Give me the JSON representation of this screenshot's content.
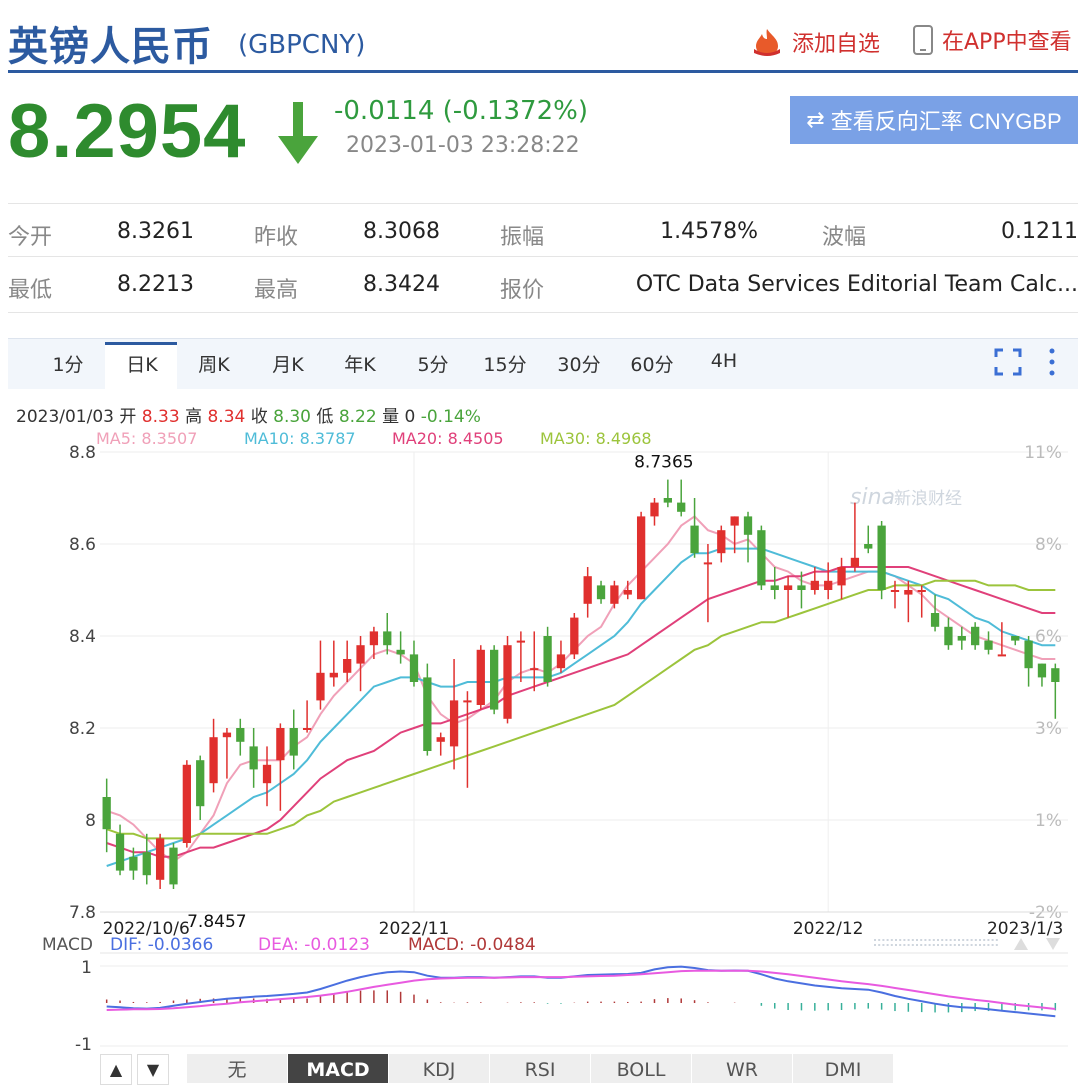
{
  "header": {
    "title": "英镑人民币",
    "code": "(GBPCNY)",
    "fav_label": "添加自选",
    "app_label": "在APP中查看"
  },
  "quote": {
    "price": "8.2954",
    "change": "-0.0114 (-0.1372%)",
    "timestamp": "2023-01-03 23:28:22",
    "reverse_label": "查看反向汇率 CNYGBP"
  },
  "stats": [
    [
      {
        "label": "今开",
        "value": "8.3261"
      },
      {
        "label": "昨收",
        "value": "8.3068"
      },
      {
        "label": "振幅",
        "value": "1.4578%"
      },
      {
        "label": "波幅",
        "value": "0.1211"
      }
    ],
    [
      {
        "label": "最低",
        "value": "8.2213"
      },
      {
        "label": "最高",
        "value": "8.3424"
      },
      {
        "label": "报价",
        "value": "OTC Data Services Editorial Team Calc..."
      }
    ]
  ],
  "tabs": [
    "1分",
    "日K",
    "周K",
    "月K",
    "年K",
    "5分",
    "15分",
    "30分",
    "60分",
    "4H"
  ],
  "active_tab": "日K",
  "info_line": {
    "date": "2023/01/03",
    "open_l": "开",
    "open": "8.33",
    "high_l": "高",
    "high": "8.34",
    "close_l": "收",
    "close": "8.30",
    "low_l": "低",
    "low": "8.22",
    "vol_l": "量",
    "vol": "0",
    "pct": "-0.14%"
  },
  "ma": [
    {
      "label": "MA5: 8.3507",
      "color": "#f0a0b8"
    },
    {
      "label": "MA10: 8.3787",
      "color": "#4fbcd8"
    },
    {
      "label": "MA20: 8.4505",
      "color": "#e0407a"
    },
    {
      "label": "MA30: 8.4968",
      "color": "#9cc43c"
    }
  ],
  "watermark": "新浪财经",
  "colors": {
    "up": "#e0302e",
    "down": "#4aa43c",
    "blue": "#2c5aa0"
  },
  "chart_data": {
    "type": "candlestick",
    "y_ticks": [
      "8.8",
      "8.6",
      "8.4",
      "8.2",
      "8",
      "7.8"
    ],
    "y_range": [
      7.8,
      8.8
    ],
    "pct_ticks": [
      "11%",
      "8%",
      "6%",
      "3%",
      "1%",
      "-2%"
    ],
    "x_labels": [
      "2022/10/6",
      "2022/11",
      "2022/12",
      "2023/1/3"
    ],
    "annotations": [
      "8.7365",
      "7.8457"
    ],
    "candles": [
      [
        8.05,
        7.98,
        8.09,
        7.93
      ],
      [
        7.97,
        7.89,
        7.99,
        7.88
      ],
      [
        7.92,
        7.89,
        7.94,
        7.87
      ],
      [
        7.93,
        7.88,
        7.97,
        7.86
      ],
      [
        7.87,
        7.96,
        7.97,
        7.85
      ],
      [
        7.94,
        7.86,
        7.95,
        7.85
      ],
      [
        7.95,
        8.12,
        8.13,
        7.94
      ],
      [
        8.13,
        8.03,
        8.14,
        8.0
      ],
      [
        8.08,
        8.18,
        8.22,
        8.06
      ],
      [
        8.18,
        8.19,
        8.2,
        8.09
      ],
      [
        8.2,
        8.17,
        8.22,
        8.14
      ],
      [
        8.16,
        8.11,
        8.2,
        8.07
      ],
      [
        8.08,
        8.12,
        8.16,
        8.03
      ],
      [
        8.13,
        8.2,
        8.21,
        8.02
      ],
      [
        8.2,
        8.14,
        8.24,
        8.11
      ],
      [
        8.2,
        8.2,
        8.26,
        8.19
      ],
      [
        8.26,
        8.32,
        8.39,
        8.24
      ],
      [
        8.31,
        8.32,
        8.39,
        8.29
      ],
      [
        8.32,
        8.35,
        8.39,
        8.3
      ],
      [
        8.34,
        8.38,
        8.4,
        8.28
      ],
      [
        8.38,
        8.41,
        8.42,
        8.35
      ],
      [
        8.41,
        8.38,
        8.45,
        8.36
      ],
      [
        8.37,
        8.36,
        8.41,
        8.34
      ],
      [
        8.36,
        8.3,
        8.39,
        8.29
      ],
      [
        8.31,
        8.15,
        8.34,
        8.14
      ],
      [
        8.17,
        8.18,
        8.19,
        8.14
      ],
      [
        8.16,
        8.26,
        8.35,
        8.11
      ],
      [
        8.26,
        8.26,
        8.28,
        8.07
      ],
      [
        8.25,
        8.37,
        8.38,
        8.24
      ],
      [
        8.37,
        8.24,
        8.38,
        8.23
      ],
      [
        8.22,
        8.38,
        8.4,
        8.21
      ],
      [
        8.39,
        8.39,
        8.41,
        8.3
      ],
      [
        8.33,
        8.33,
        8.41,
        8.28
      ],
      [
        8.4,
        8.3,
        8.42,
        8.29
      ],
      [
        8.33,
        8.36,
        8.39,
        8.32
      ],
      [
        8.36,
        8.44,
        8.45,
        8.35
      ],
      [
        8.47,
        8.53,
        8.55,
        8.44
      ],
      [
        8.51,
        8.48,
        8.52,
        8.47
      ],
      [
        8.47,
        8.51,
        8.52,
        8.46
      ],
      [
        8.49,
        8.5,
        8.52,
        8.48
      ],
      [
        8.48,
        8.66,
        8.67,
        8.48
      ],
      [
        8.66,
        8.69,
        8.7,
        8.64
      ],
      [
        8.7,
        8.69,
        8.74,
        8.68
      ],
      [
        8.69,
        8.67,
        8.74,
        8.66
      ],
      [
        8.64,
        8.58,
        8.7,
        8.57
      ],
      [
        8.56,
        8.56,
        8.6,
        8.43
      ],
      [
        8.58,
        8.63,
        8.64,
        8.56
      ],
      [
        8.64,
        8.66,
        8.66,
        8.58
      ],
      [
        8.66,
        8.62,
        8.67,
        8.56
      ],
      [
        8.63,
        8.51,
        8.64,
        8.5
      ],
      [
        8.51,
        8.5,
        8.55,
        8.48
      ],
      [
        8.5,
        8.51,
        8.53,
        8.44
      ],
      [
        8.51,
        8.5,
        8.54,
        8.46
      ],
      [
        8.5,
        8.52,
        8.55,
        8.49
      ],
      [
        8.5,
        8.52,
        8.56,
        8.48
      ],
      [
        8.51,
        8.55,
        8.57,
        8.48
      ],
      [
        8.55,
        8.57,
        8.69,
        8.54
      ],
      [
        8.6,
        8.59,
        8.64,
        8.58
      ],
      [
        8.64,
        8.5,
        8.65,
        8.48
      ],
      [
        8.5,
        8.5,
        8.52,
        8.46
      ],
      [
        8.49,
        8.5,
        8.52,
        8.43
      ],
      [
        8.5,
        8.5,
        8.51,
        8.44
      ],
      [
        8.45,
        8.42,
        8.49,
        8.41
      ],
      [
        8.42,
        8.38,
        8.44,
        8.37
      ],
      [
        8.4,
        8.39,
        8.42,
        8.37
      ],
      [
        8.42,
        8.38,
        8.43,
        8.37
      ],
      [
        8.39,
        8.37,
        8.41,
        8.36
      ],
      [
        8.36,
        8.36,
        8.43,
        8.36
      ],
      [
        8.4,
        8.39,
        8.4,
        8.38
      ],
      [
        8.39,
        8.33,
        8.4,
        8.29
      ],
      [
        8.34,
        8.31,
        8.34,
        8.29
      ],
      [
        8.33,
        8.3,
        8.34,
        8.22
      ]
    ],
    "ma_series": {
      "MA5": [
        8.02,
        8.01,
        7.99,
        7.96,
        7.93,
        7.91,
        7.93,
        7.97,
        8.01,
        8.08,
        8.12,
        8.13,
        8.13,
        8.13,
        8.16,
        8.18,
        8.23,
        8.27,
        8.3,
        8.33,
        8.36,
        8.37,
        8.36,
        8.34,
        8.27,
        8.23,
        8.21,
        8.22,
        8.24,
        8.26,
        8.3,
        8.32,
        8.33,
        8.32,
        8.34,
        8.37,
        8.4,
        8.42,
        8.47,
        8.51,
        8.54,
        8.57,
        8.6,
        8.64,
        8.66,
        8.63,
        8.62,
        8.6,
        8.61,
        8.58,
        8.55,
        8.54,
        8.52,
        8.51,
        8.51,
        8.52,
        8.53,
        8.54,
        8.54,
        8.53,
        8.51,
        8.49,
        8.46,
        8.44,
        8.42,
        8.4,
        8.39,
        8.38,
        8.37,
        8.36,
        8.35,
        8.35
      ],
      "MA10": [
        7.9,
        7.91,
        7.92,
        7.93,
        7.94,
        7.95,
        7.96,
        7.97,
        7.99,
        8.01,
        8.03,
        8.05,
        8.06,
        8.08,
        8.1,
        8.13,
        8.17,
        8.2,
        8.23,
        8.26,
        8.29,
        8.3,
        8.31,
        8.31,
        8.3,
        8.29,
        8.29,
        8.3,
        8.3,
        8.3,
        8.31,
        8.31,
        8.31,
        8.31,
        8.32,
        8.34,
        8.36,
        8.38,
        8.4,
        8.43,
        8.47,
        8.5,
        8.53,
        8.56,
        8.58,
        8.58,
        8.59,
        8.59,
        8.59,
        8.59,
        8.58,
        8.57,
        8.56,
        8.55,
        8.54,
        8.54,
        8.54,
        8.54,
        8.54,
        8.53,
        8.52,
        8.51,
        8.49,
        8.48,
        8.46,
        8.44,
        8.43,
        8.41,
        8.4,
        8.39,
        8.38,
        8.38
      ],
      "MA20": [
        7.95,
        7.94,
        7.93,
        7.93,
        7.92,
        7.92,
        7.93,
        7.94,
        7.94,
        7.95,
        7.96,
        7.97,
        7.98,
        8.0,
        8.03,
        8.06,
        8.09,
        8.11,
        8.13,
        8.14,
        8.15,
        8.17,
        8.19,
        8.2,
        8.21,
        8.21,
        8.22,
        8.23,
        8.24,
        8.25,
        8.27,
        8.28,
        8.29,
        8.3,
        8.31,
        8.32,
        8.33,
        8.34,
        8.35,
        8.36,
        8.38,
        8.4,
        8.42,
        8.44,
        8.46,
        8.48,
        8.49,
        8.5,
        8.51,
        8.52,
        8.52,
        8.53,
        8.53,
        8.54,
        8.54,
        8.55,
        8.55,
        8.55,
        8.55,
        8.55,
        8.55,
        8.54,
        8.53,
        8.52,
        8.51,
        8.5,
        8.49,
        8.48,
        8.47,
        8.46,
        8.45,
        8.45
      ],
      "MA30": [
        7.98,
        7.97,
        7.97,
        7.96,
        7.96,
        7.96,
        7.96,
        7.97,
        7.97,
        7.97,
        7.97,
        7.97,
        7.97,
        7.98,
        7.99,
        8.01,
        8.02,
        8.04,
        8.05,
        8.06,
        8.07,
        8.08,
        8.09,
        8.1,
        8.11,
        8.12,
        8.13,
        8.14,
        8.15,
        8.16,
        8.17,
        8.18,
        8.19,
        8.2,
        8.21,
        8.22,
        8.23,
        8.24,
        8.25,
        8.27,
        8.29,
        8.31,
        8.33,
        8.35,
        8.37,
        8.38,
        8.4,
        8.41,
        8.42,
        8.43,
        8.43,
        8.44,
        8.45,
        8.46,
        8.47,
        8.48,
        8.49,
        8.5,
        8.5,
        8.51,
        8.51,
        8.51,
        8.52,
        8.52,
        8.52,
        8.52,
        8.51,
        8.51,
        8.51,
        8.5,
        8.5,
        8.5
      ]
    },
    "macd": {
      "title": "MACD",
      "dif_label": "DIF: -0.0366",
      "dea_label": "DEA: -0.0123",
      "macd_label": "MACD: -0.0484",
      "y_ticks": [
        "1",
        "-1"
      ],
      "dif": [
        -0.1,
        -0.12,
        -0.15,
        -0.16,
        -0.14,
        -0.08,
        -0.02,
        0.03,
        0.08,
        0.12,
        0.15,
        0.18,
        0.2,
        0.23,
        0.26,
        0.3,
        0.4,
        0.52,
        0.64,
        0.74,
        0.82,
        0.88,
        0.9,
        0.88,
        0.78,
        0.72,
        0.72,
        0.74,
        0.74,
        0.72,
        0.74,
        0.76,
        0.76,
        0.72,
        0.72,
        0.76,
        0.8,
        0.81,
        0.82,
        0.83,
        0.86,
        0.96,
        1.02,
        1.04,
        1.0,
        0.94,
        0.92,
        0.93,
        0.92,
        0.82,
        0.7,
        0.62,
        0.56,
        0.5,
        0.46,
        0.42,
        0.4,
        0.38,
        0.3,
        0.2,
        0.12,
        0.05,
        -0.02,
        -0.08,
        -0.12,
        -0.14,
        -0.18,
        -0.22,
        -0.26,
        -0.3,
        -0.34,
        -0.38
      ],
      "dea": [
        -0.2,
        -0.19,
        -0.18,
        -0.18,
        -0.17,
        -0.15,
        -0.12,
        -0.09,
        -0.05,
        -0.02,
        0.02,
        0.05,
        0.08,
        0.11,
        0.14,
        0.17,
        0.21,
        0.26,
        0.32,
        0.39,
        0.46,
        0.52,
        0.58,
        0.64,
        0.68,
        0.7,
        0.71,
        0.72,
        0.72,
        0.72,
        0.73,
        0.74,
        0.74,
        0.74,
        0.74,
        0.75,
        0.76,
        0.77,
        0.78,
        0.8,
        0.82,
        0.85,
        0.88,
        0.91,
        0.92,
        0.92,
        0.92,
        0.92,
        0.92,
        0.9,
        0.86,
        0.82,
        0.77,
        0.72,
        0.67,
        0.62,
        0.58,
        0.54,
        0.49,
        0.43,
        0.37,
        0.31,
        0.25,
        0.19,
        0.14,
        0.09,
        0.05,
        0.0,
        -0.05,
        -0.09,
        -0.13,
        -0.17
      ]
    },
    "bottom_tabs": [
      "无",
      "MACD",
      "KDJ",
      "RSI",
      "BOLL",
      "WR",
      "DMI"
    ],
    "active_bottom_tab": "MACD"
  }
}
